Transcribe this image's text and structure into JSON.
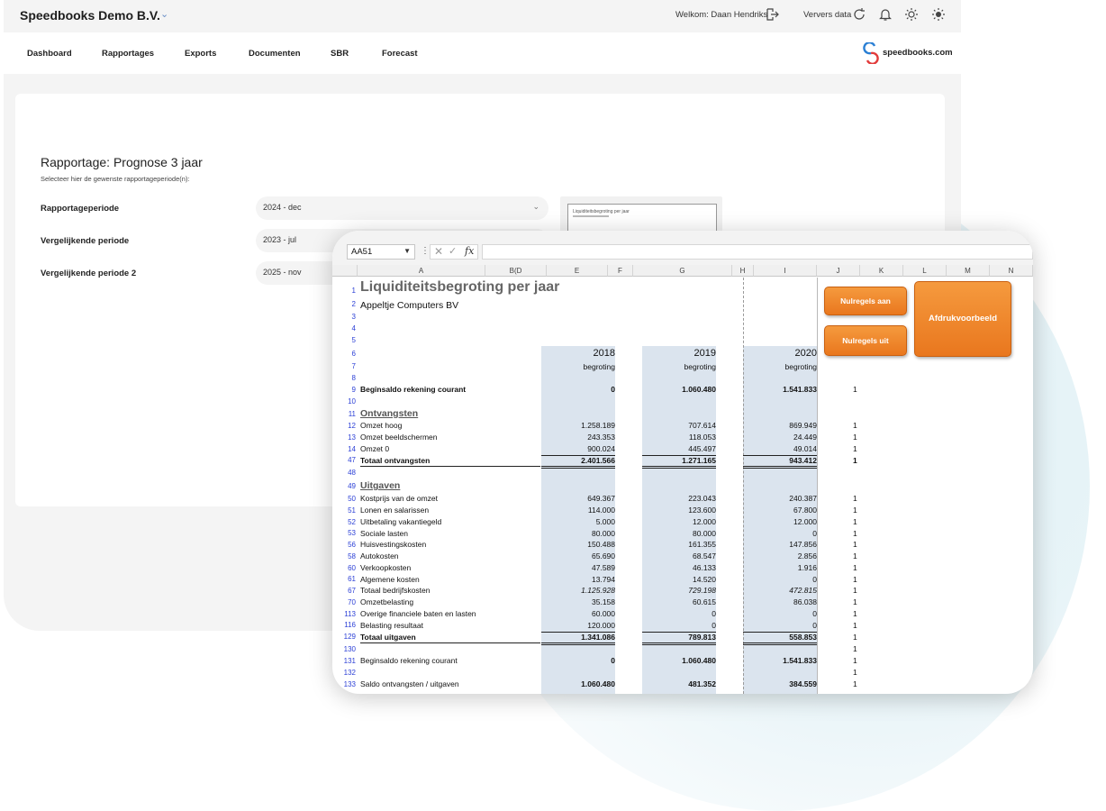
{
  "app": {
    "company": "Speedbooks Demo B.V.",
    "welcome": "Welkom: Daan Hendriks",
    "refresh": "Ververs data",
    "logo": "speedbooks.com"
  },
  "nav": [
    "Dashboard",
    "Rapportages",
    "Exports",
    "Documenten",
    "SBR",
    "Forecast"
  ],
  "report": {
    "title": "Rapportage: Prognose 3 jaar",
    "subtitle": "Selecteer hier de gewenste rapportageperiode(n):",
    "fields": [
      {
        "label": "Rapportageperiode",
        "value": "2024 - dec"
      },
      {
        "label": "Vergelijkende periode",
        "value": "2023 - jul"
      },
      {
        "label": "Vergelijkende periode 2",
        "value": "2025 - nov"
      }
    ],
    "preview_title": "Liquiditeitsbegroting per jaar"
  },
  "excel": {
    "namebox": "AA51",
    "fx": "fx",
    "columns": [
      "A",
      "B(D",
      "E",
      "F",
      "G",
      "H",
      "I",
      "J",
      "K",
      "L",
      "M",
      "N"
    ],
    "rownums": [
      "1",
      "2",
      "3",
      "4",
      "5",
      "6",
      "7",
      "8",
      "9",
      "10",
      "11",
      "12",
      "13",
      "14",
      "47",
      "48",
      "49",
      "50",
      "51",
      "52",
      "53",
      "56",
      "58",
      "60",
      "61",
      "67",
      "70",
      "113",
      "116",
      "129",
      "130",
      "131",
      "132",
      "133"
    ],
    "title": "Liquiditeitsbegroting per jaar",
    "subtitle": "Appeltje Computers BV",
    "years": [
      "2018",
      "2019",
      "2020"
    ],
    "begroting": "begroting",
    "buttons": {
      "aan": "Nulregels aan",
      "uit": "Nulregels uit",
      "afdruk": "Afdrukvoorbeeld"
    },
    "sections": {
      "ontvangsten": "Ontvangsten",
      "uitgaven": "Uitgaven"
    },
    "rows": [
      {
        "label": "Beginsaldo rekening courant",
        "v": [
          "0",
          "1.060.480",
          "1.541.833"
        ],
        "j": "1",
        "bold": true
      },
      {
        "label": "Omzet hoog",
        "v": [
          "1.258.189",
          "707.614",
          "869.949"
        ],
        "j": "1"
      },
      {
        "label": "Omzet beeldschermen",
        "v": [
          "243.353",
          "118.053",
          "24.449"
        ],
        "j": "1"
      },
      {
        "label": "Omzet 0",
        "v": [
          "900.024",
          "445.497",
          "49.014"
        ],
        "j": "1"
      },
      {
        "label": "Totaal ontvangsten",
        "v": [
          "2.401.566",
          "1.271.165",
          "943.412"
        ],
        "j": "1",
        "bold": true
      },
      {
        "label": "Kostprijs van de omzet",
        "v": [
          "649.367",
          "223.043",
          "240.387"
        ],
        "j": "1"
      },
      {
        "label": "Lonen en salarissen",
        "v": [
          "114.000",
          "123.600",
          "67.800"
        ],
        "j": "1"
      },
      {
        "label": "Uitbetaling vakantiegeld",
        "v": [
          "5.000",
          "12.000",
          "12.000"
        ],
        "j": "1"
      },
      {
        "label": "Sociale lasten",
        "v": [
          "80.000",
          "80.000",
          "0"
        ],
        "j": "1"
      },
      {
        "label": "Huisvestingskosten",
        "v": [
          "150.488",
          "161.355",
          "147.856"
        ],
        "j": "1"
      },
      {
        "label": "Autokosten",
        "v": [
          "65.690",
          "68.547",
          "2.856"
        ],
        "j": "1"
      },
      {
        "label": "Verkoopkosten",
        "v": [
          "47.589",
          "46.133",
          "1.916"
        ],
        "j": "1"
      },
      {
        "label": "Algemene kosten",
        "v": [
          "13.794",
          "14.520",
          "0"
        ],
        "j": "1"
      },
      {
        "label": "Totaal bedrijfskosten",
        "v": [
          "1.125.928",
          "729.198",
          "472.815"
        ],
        "j": "1",
        "italic": true
      },
      {
        "label": "Omzetbelasting",
        "v": [
          "35.158",
          "60.615",
          "86.038"
        ],
        "j": "1"
      },
      {
        "label": "Overige financiele baten en lasten",
        "v": [
          "60.000",
          "0",
          "0"
        ],
        "j": "1"
      },
      {
        "label": "Belasting resultaat",
        "v": [
          "120.000",
          "0",
          "0"
        ],
        "j": "1"
      },
      {
        "label": "Totaal uitgaven",
        "v": [
          "1.341.086",
          "789.813",
          "558.853"
        ],
        "j": "1",
        "bold": true
      },
      {
        "label": "",
        "v": [
          "",
          "",
          ""
        ],
        "j": "1"
      },
      {
        "label": "Beginsaldo rekening courant",
        "v": [
          "0",
          "1.060.480",
          "1.541.833"
        ],
        "j": "1",
        "boldnum": true
      },
      {
        "label": "",
        "v": [
          "",
          "",
          ""
        ],
        "j": "1"
      },
      {
        "label": "Saldo ontvangsten / uitgaven",
        "v": [
          "1.060.480",
          "481.352",
          "384.559"
        ],
        "j": "1",
        "boldnum": true
      }
    ]
  },
  "colors": {
    "accent": "#e9771e",
    "shade": "#dbe4ee",
    "rownum": "#2b3fd6"
  }
}
